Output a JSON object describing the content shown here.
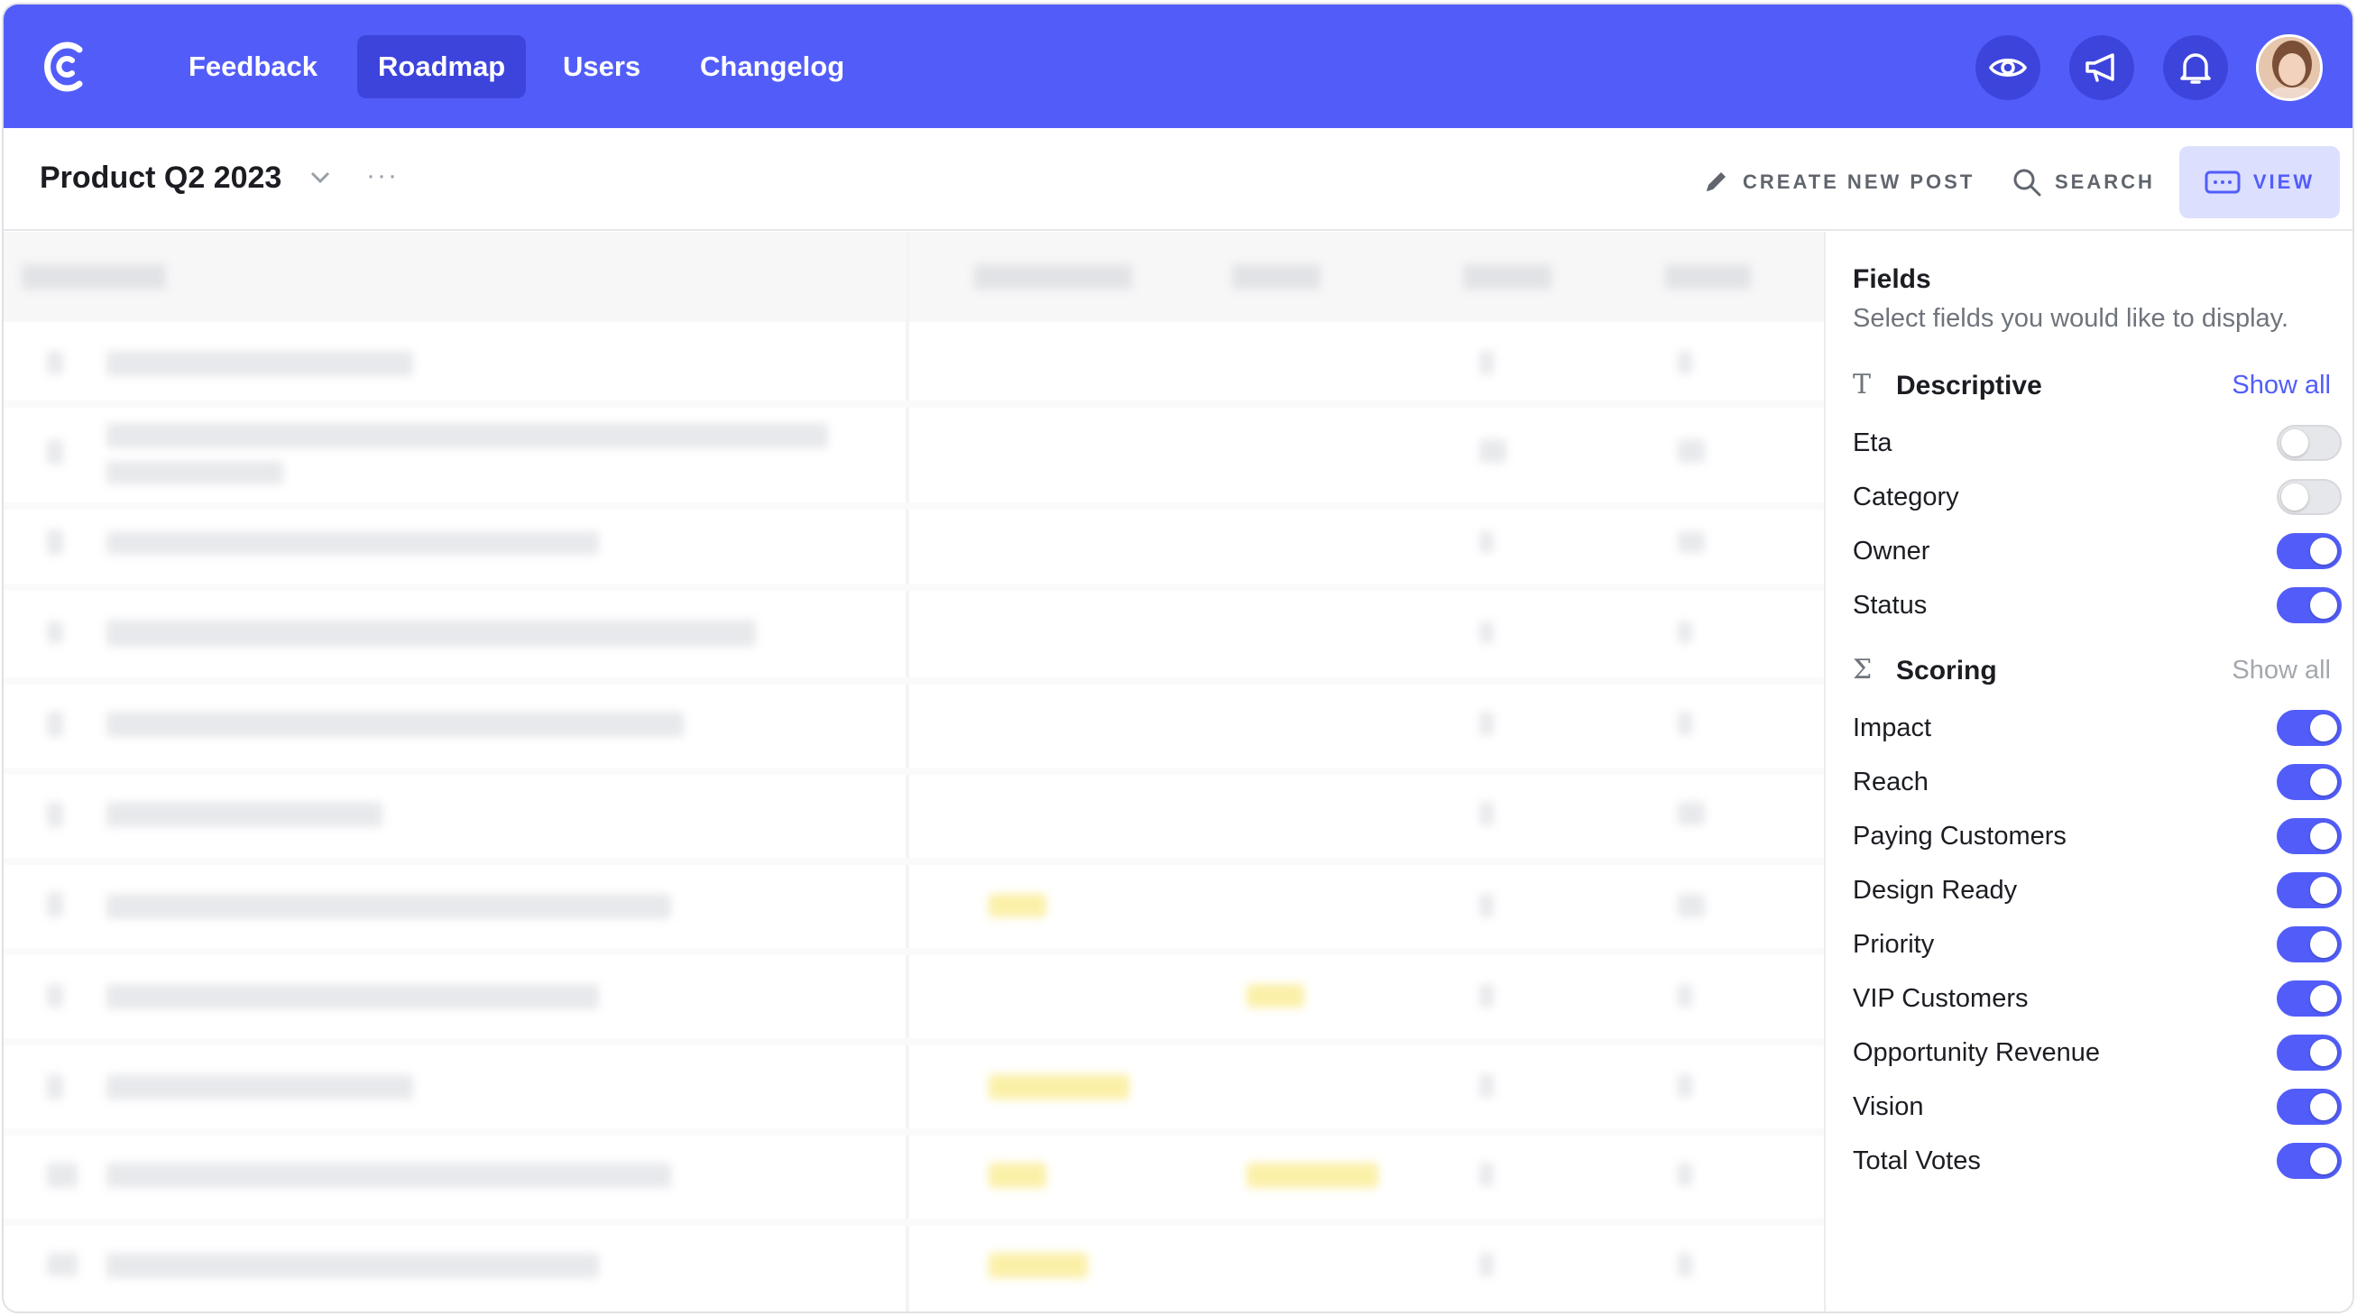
{
  "nav": {
    "links": [
      {
        "label": "Feedback",
        "active": false
      },
      {
        "label": "Roadmap",
        "active": true
      },
      {
        "label": "Users",
        "active": false
      },
      {
        "label": "Changelog",
        "active": false
      }
    ],
    "icons": [
      "eye-icon",
      "megaphone-icon",
      "bell-icon"
    ],
    "accent": "#525df9",
    "accent_dark": "#3d44dc"
  },
  "toolbar": {
    "board_title": "Product Q2 2023",
    "more": "···",
    "create_label": "CREATE NEW POST",
    "search_label": "SEARCH",
    "view_label": "VIEW"
  },
  "panel": {
    "title": "Fields",
    "subtitle": "Select fields you would like to display.",
    "groups": [
      {
        "label": "Descriptive",
        "icon": "T",
        "show_all": "Show all",
        "fields": [
          {
            "label": "Eta",
            "on": false
          },
          {
            "label": "Category",
            "on": false
          },
          {
            "label": "Owner",
            "on": true
          },
          {
            "label": "Status",
            "on": true
          }
        ]
      },
      {
        "label": "Scoring",
        "icon": "Σ",
        "show_all": "Show all",
        "fields": [
          {
            "label": "Impact",
            "on": true
          },
          {
            "label": "Reach",
            "on": true
          },
          {
            "label": "Paying Customers",
            "on": true
          },
          {
            "label": "Design Ready",
            "on": true
          },
          {
            "label": "Priority",
            "on": true
          },
          {
            "label": "VIP Customers",
            "on": true
          },
          {
            "label": "Opportunity Revenue",
            "on": true
          },
          {
            "label": "Vision",
            "on": true
          },
          {
            "label": "Total Votes",
            "on": true
          }
        ]
      }
    ]
  }
}
